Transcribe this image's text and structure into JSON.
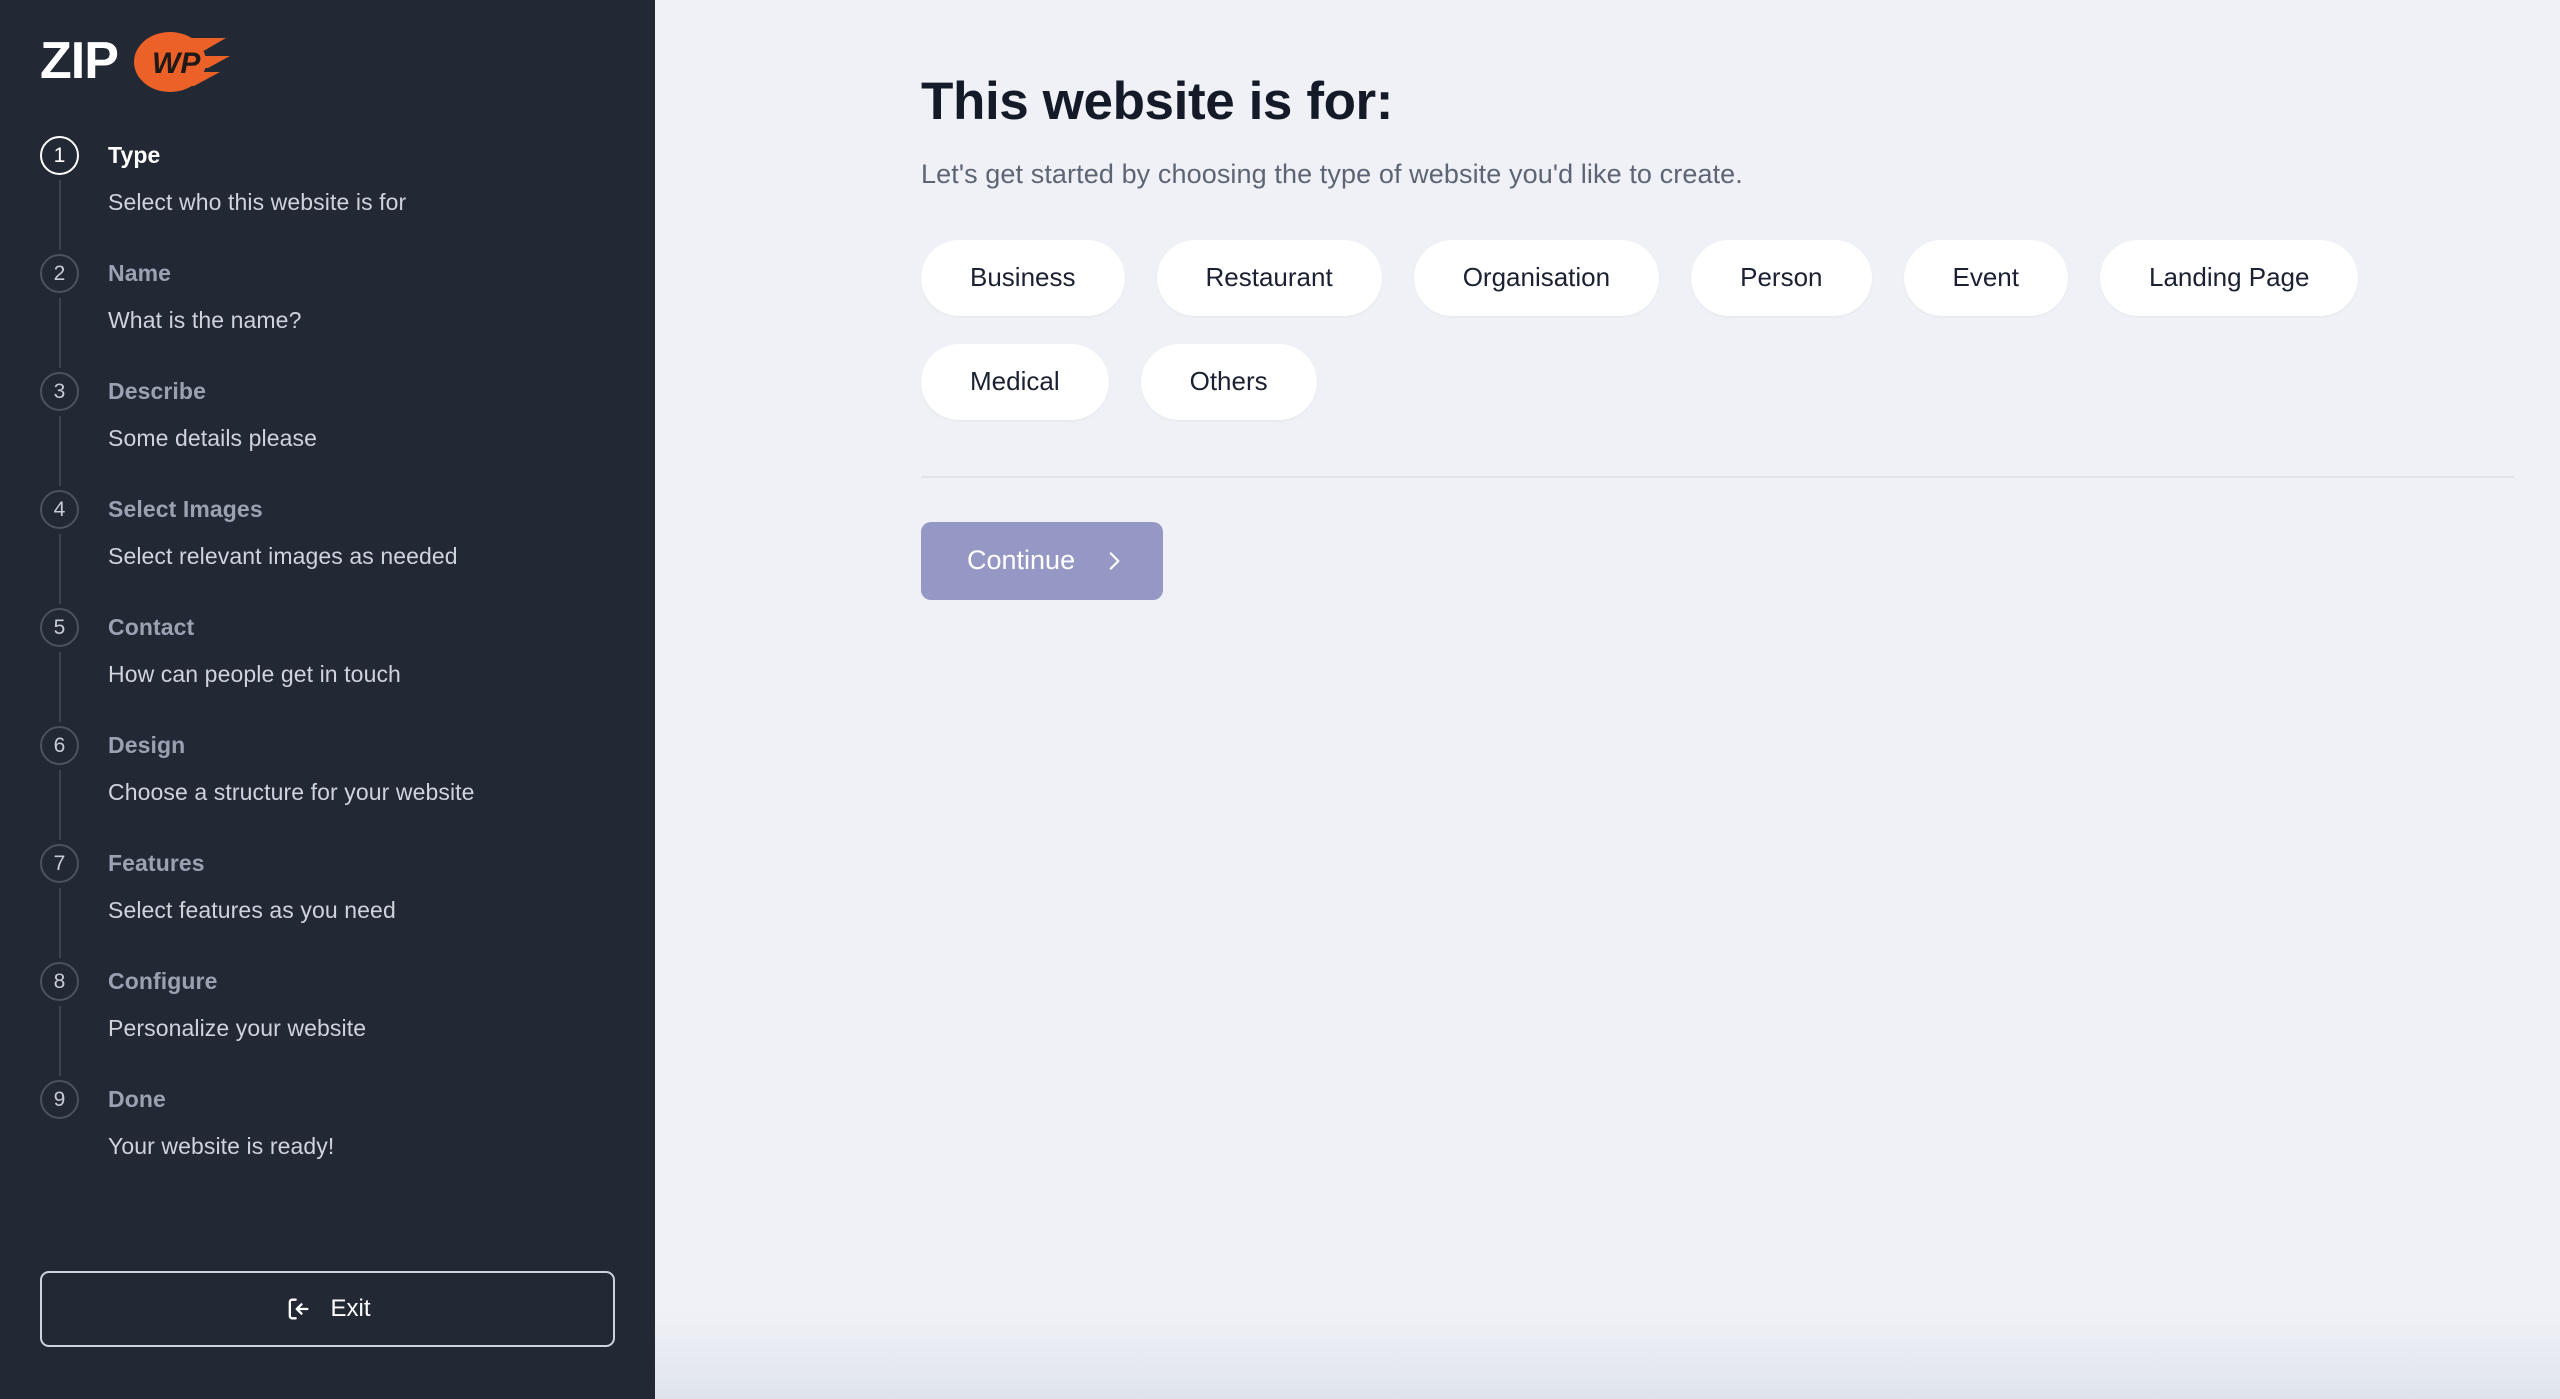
{
  "brand": {
    "name": "ZipWP",
    "zip_text": "ZIP",
    "wp_text": "WP",
    "accent_color": "#ec6128",
    "sidebar_color": "#222834"
  },
  "sidebar": {
    "steps": [
      {
        "number": "1",
        "title": "Type",
        "subtitle": "Select who this website is for",
        "active": true
      },
      {
        "number": "2",
        "title": "Name",
        "subtitle": "What is the name?",
        "active": false
      },
      {
        "number": "3",
        "title": "Describe",
        "subtitle": "Some details please",
        "active": false
      },
      {
        "number": "4",
        "title": "Select Images",
        "subtitle": "Select relevant images as needed",
        "active": false
      },
      {
        "number": "5",
        "title": "Contact",
        "subtitle": "How can people get in touch",
        "active": false
      },
      {
        "number": "6",
        "title": "Design",
        "subtitle": "Choose a structure for your website",
        "active": false
      },
      {
        "number": "7",
        "title": "Features",
        "subtitle": "Select features as you need",
        "active": false
      },
      {
        "number": "8",
        "title": "Configure",
        "subtitle": "Personalize your website",
        "active": false
      },
      {
        "number": "9",
        "title": "Done",
        "subtitle": "Your website is ready!",
        "active": false
      }
    ],
    "exit_label": "Exit",
    "exit_icon": "exit-icon"
  },
  "main": {
    "title": "This website is for:",
    "subtitle": "Let's get started by choosing the type of website you'd like to create.",
    "website_types": [
      "Business",
      "Restaurant",
      "Organisation",
      "Person",
      "Event",
      "Landing Page",
      "Medical",
      "Others"
    ],
    "continue_label": "Continue",
    "continue_icon": "chevron-right-icon",
    "continue_color": "#9598c4"
  }
}
